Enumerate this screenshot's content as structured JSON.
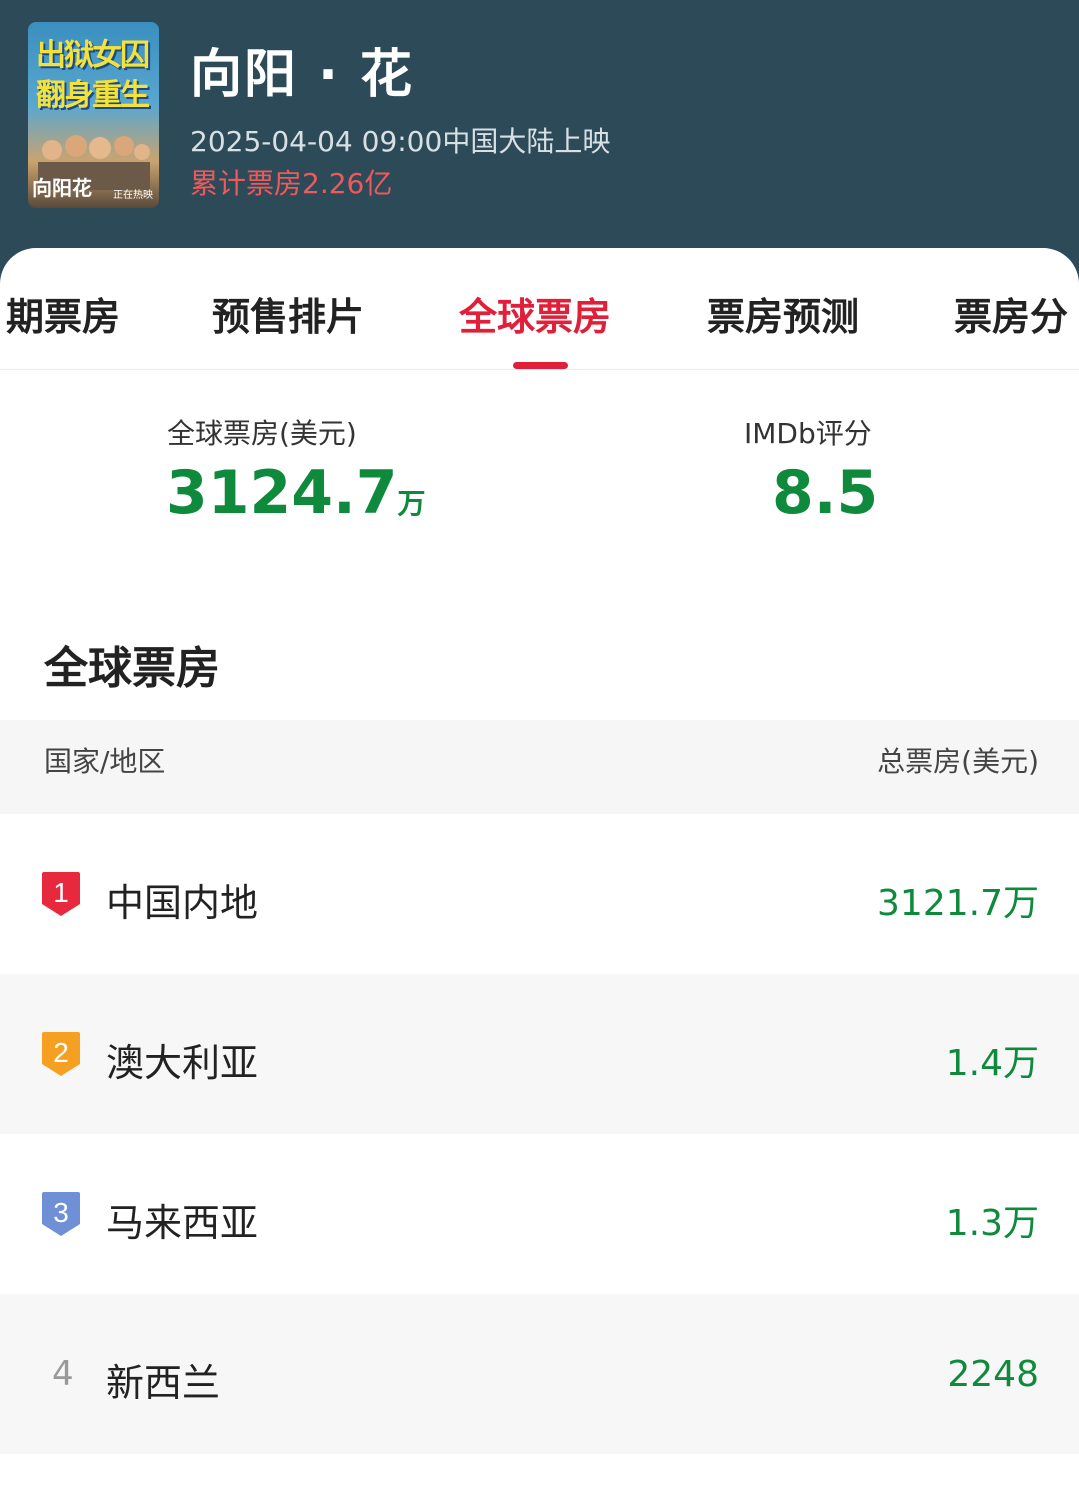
{
  "header": {
    "poster": {
      "tagline_line1": "出狱女囚",
      "tagline_line2": "翻身重生",
      "logo_text": "向阳花",
      "now_showing": "正在热映"
    },
    "title": "向阳 · 花",
    "release_info": "2025-04-04 09:00中国大陆上映",
    "cumulative_box_office": "累计票房2.26亿"
  },
  "tabs": [
    {
      "label": "期票房",
      "active": false
    },
    {
      "label": "预售排片",
      "active": false
    },
    {
      "label": "全球票房",
      "active": true
    },
    {
      "label": "票房预测",
      "active": false
    },
    {
      "label": "票房分",
      "active": false
    }
  ],
  "stats": {
    "global_label": "全球票房(美元)",
    "global_value": "3124.7",
    "global_unit": "万",
    "imdb_label": "IMDb评分",
    "imdb_value": "8.5"
  },
  "section_title": "全球票房",
  "table": {
    "col_region": "国家/地区",
    "col_total": "总票房(美元)",
    "rows": [
      {
        "rank": "1",
        "region": "中国内地",
        "value": "3121.7万"
      },
      {
        "rank": "2",
        "region": "澳大利亚",
        "value": "1.4万"
      },
      {
        "rank": "3",
        "region": "马来西亚",
        "value": "1.3万"
      },
      {
        "rank": "4",
        "region": "新西兰",
        "value": "2248"
      }
    ]
  },
  "colors": {
    "header_bg": "#2d4a58",
    "accent_red": "#e0203a",
    "value_green": "#0f8a3c",
    "rank1": "#e8283c",
    "rank2": "#f5a021",
    "rank3": "#6f8fd6"
  }
}
